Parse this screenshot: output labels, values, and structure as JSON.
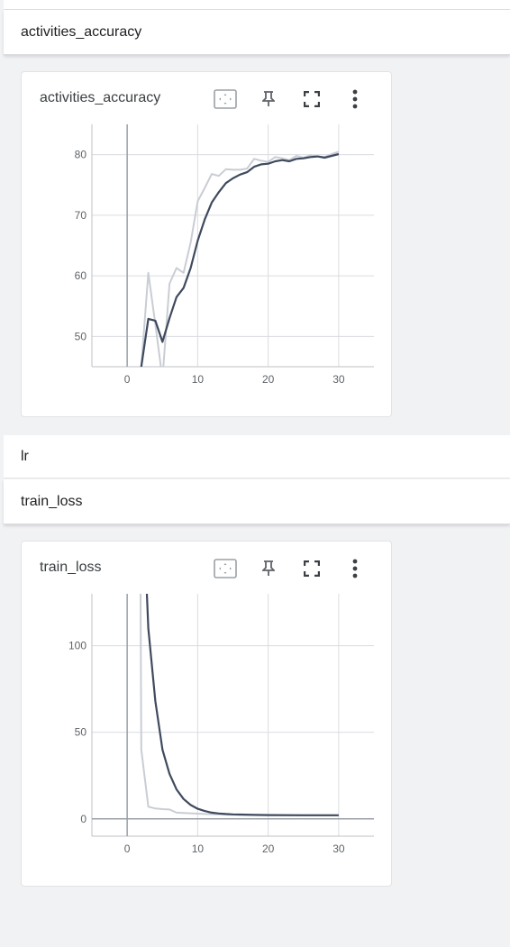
{
  "groups": {
    "activities_accuracy": {
      "label": "activities_accuracy"
    },
    "lr": {
      "label": "lr"
    },
    "train_loss": {
      "label": "train_loss"
    }
  },
  "cards": [
    {
      "title": "activities_accuracy"
    },
    {
      "title": "train_loss"
    }
  ],
  "toolbar_icons": [
    "fit-domain-icon",
    "pin-icon",
    "fullscreen-icon",
    "more-vert-icon"
  ],
  "colors": {
    "raw": "#c9cdd4",
    "smoothed": "#3f4a5e",
    "grid": "#dadce0",
    "axis": "#9aa0a6"
  },
  "chart_data": [
    {
      "type": "line",
      "title": "activities_accuracy",
      "xlim": [
        -5,
        35
      ],
      "ylim": [
        45,
        85
      ],
      "xticks": [
        0,
        10,
        20,
        30
      ],
      "yticks": [
        50,
        60,
        70,
        80
      ],
      "grid": true,
      "series": [
        {
          "x": [
            2,
            3,
            4,
            5,
            6,
            7,
            8,
            9,
            10,
            11,
            12,
            13,
            14,
            15,
            16,
            17,
            18,
            19,
            20,
            21,
            22,
            23,
            24,
            25,
            26,
            27,
            28,
            29,
            30
          ],
          "values": [
            45,
            60.5,
            52,
            43,
            58.7,
            61.3,
            60.5,
            65.5,
            72.3,
            74.5,
            76.8,
            76.5,
            77.6,
            77.5,
            77.5,
            77.7,
            79.3,
            79,
            78.8,
            79.6,
            79.4,
            79.1,
            79.8,
            79.5,
            79.9,
            79.7,
            79.6,
            80.1,
            80.5
          ]
        },
        {
          "x": [
            2,
            3,
            4,
            5,
            6,
            7,
            8,
            9,
            10,
            11,
            12,
            13,
            14,
            15,
            16,
            17,
            18,
            19,
            20,
            21,
            22,
            23,
            24,
            25,
            26,
            27,
            28,
            29,
            30
          ],
          "values": [
            45,
            52.9,
            52.6,
            49.1,
            53,
            56.5,
            58,
            61.3,
            65.8,
            69.3,
            72.1,
            73.8,
            75.3,
            76.1,
            76.7,
            77.1,
            78,
            78.4,
            78.5,
            78.9,
            79.1,
            78.9,
            79.3,
            79.4,
            79.6,
            79.7,
            79.5,
            79.8,
            80.1
          ]
        }
      ]
    },
    {
      "type": "line",
      "title": "train_loss",
      "xlim": [
        -5,
        35
      ],
      "ylim": [
        -10,
        130
      ],
      "xticks": [
        0,
        10,
        20,
        30
      ],
      "yticks": [
        0,
        50,
        100
      ],
      "grid": true,
      "series": [
        {
          "x": [
            1.9,
            2,
            3,
            4,
            5,
            6,
            7,
            8,
            9,
            10,
            11,
            12,
            13,
            14,
            15,
            20,
            25,
            30
          ],
          "values": [
            130,
            40,
            7,
            6,
            5.6,
            5.4,
            3.6,
            3.4,
            3.2,
            3,
            2.8,
            2.7,
            2.6,
            2.5,
            2.4,
            2.3,
            2.2,
            2.1
          ]
        },
        {
          "x": [
            2.8,
            3,
            4,
            5,
            6,
            7,
            8,
            9,
            10,
            11,
            12,
            13,
            14,
            15,
            16,
            18,
            20,
            25,
            30
          ],
          "values": [
            130,
            110,
            68,
            40,
            26,
            17,
            11.5,
            8,
            5.8,
            4.5,
            3.6,
            3.1,
            2.8,
            2.6,
            2.5,
            2.3,
            2.2,
            2.1,
            2.1
          ]
        }
      ]
    }
  ]
}
